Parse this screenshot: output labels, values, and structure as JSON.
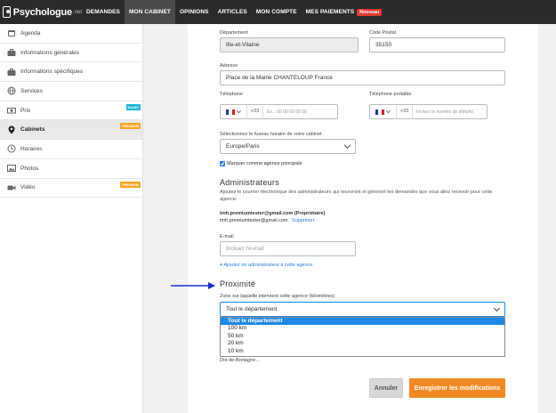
{
  "nav": {
    "logo_text": "Psychologue",
    "logo_suffix": ".net",
    "items": [
      {
        "label": "DEMANDES"
      },
      {
        "label": "MON CABINET"
      },
      {
        "label": "OPINIONS"
      },
      {
        "label": "ARTICLES"
      },
      {
        "label": "MON COMPTE"
      },
      {
        "label": "MES PAIEMENTS"
      }
    ],
    "new_badge": "Nouveau"
  },
  "sidebar": {
    "items": [
      {
        "label": "Agenda",
        "icon": "calendar-icon"
      },
      {
        "label": "Informations générales",
        "icon": "briefcase-icon"
      },
      {
        "label": "Informations spécifiques",
        "icon": "briefcase-icon"
      },
      {
        "label": "Services",
        "icon": "globe-icon"
      },
      {
        "label": "Prix",
        "icon": "money-icon",
        "badge": "BASIC"
      },
      {
        "label": "Cabinets",
        "icon": "map-pin-icon",
        "badge": "PREMIUM"
      },
      {
        "label": "Horaires",
        "icon": "clock-icon"
      },
      {
        "label": "Photos",
        "icon": "image-icon"
      },
      {
        "label": "Vidéo",
        "icon": "video-icon",
        "badge": "PREMIUM"
      }
    ]
  },
  "form": {
    "departement_label": "Département",
    "departement_value": "Ille-et-Vilaine",
    "code_postal_label": "Code Postal",
    "code_postal_value": "35150",
    "adresse_label": "Adresse",
    "adresse_value": "Place de la Mairie  CHANTELOUP France",
    "telephone_label": "Téléphone",
    "telephone_prefix": "+33",
    "telephone_placeholder": "Ex. : 00 00 00 00 00",
    "portable_label": "Téléphone portable",
    "portable_prefix": "+33",
    "portable_placeholder": "Incluez le numéro de télépho",
    "timezone_label": "Sélectionnez le fuseau horaire de votre cabinet",
    "timezone_value": "Europe/Paris",
    "main_agency_label": "Marquer comme agence principale"
  },
  "admins": {
    "title": "Administrateurs",
    "description": "Ajoutez le courrier électronique des administrateurs qui recevront et géreront les demandes que vous allez recevoir pour cette agence.",
    "owner": "tmh.premiumtester@gmail.com (Propriétaire)",
    "admin_email": "tmh.premiumtester@gmail.com",
    "remove_link": "Supprimer",
    "email_label": "E-mail",
    "email_placeholder": "Incluez l'e-mail",
    "add_admin_link": "Ajoutez un administrateur à cette agence"
  },
  "proximity": {
    "title": "Proximité",
    "zone_label": "Zone sur laquelle intervient cette agence (kilomètres)",
    "selected": "Tout le département",
    "options": [
      "Tout le département",
      "100 km",
      "50 km",
      "20 km",
      "10 km"
    ],
    "town_below": "Dol-de-Bretagne..."
  },
  "buttons": {
    "cancel": "Annuler",
    "save": "Enregistrer les modifications"
  },
  "colors": {
    "nav_bg": "#2b2b2b",
    "accent_blue": "#1e88e5",
    "save_orange": "#f08a24",
    "basic_badge": "#1bb3d6",
    "premium_badge": "#f5a623",
    "arrow": "#1a2ed1"
  }
}
